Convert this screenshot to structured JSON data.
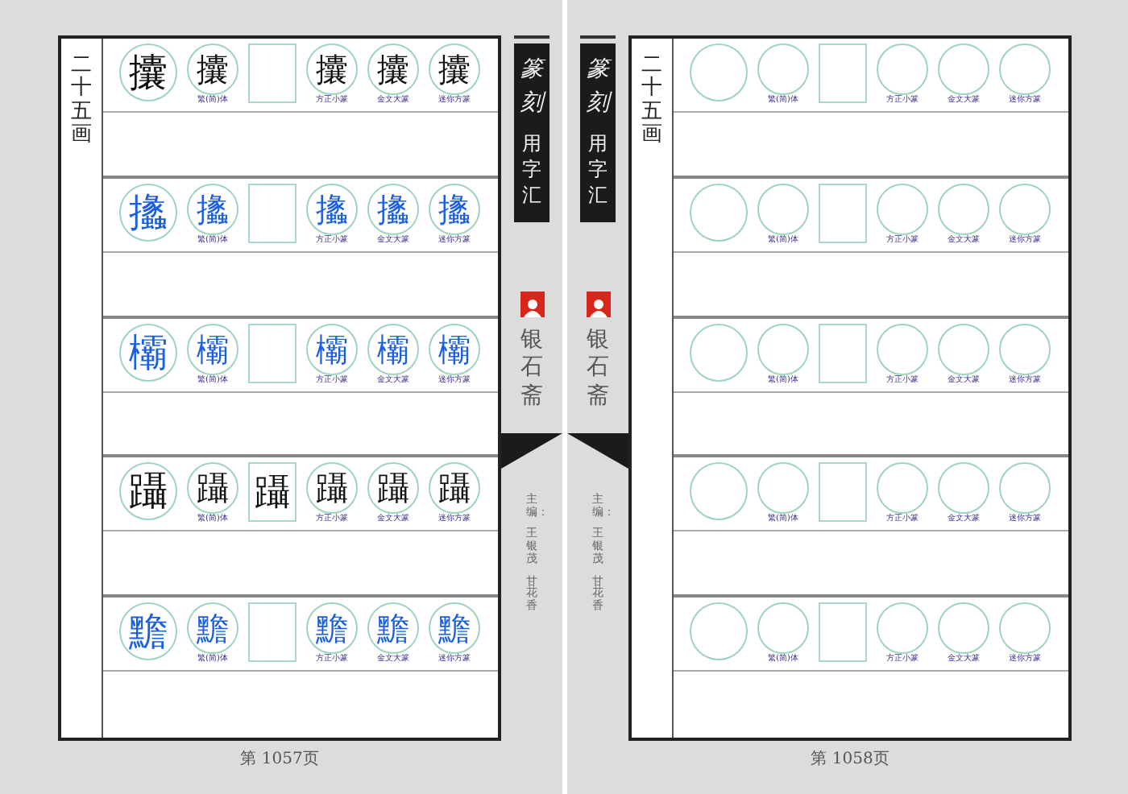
{
  "pages": [
    {
      "stroke_label": "二十五画",
      "page_number": "第 1057页",
      "rows": [
        {
          "color": "#111111",
          "slots": [
            {
              "kind": "large",
              "text": "攮"
            },
            {
              "kind": "small",
              "text": "攮",
              "caption": "繁(简)体"
            },
            {
              "kind": "box"
            },
            {
              "kind": "small",
              "text": "攮",
              "caption": "方正小篆"
            },
            {
              "kind": "small",
              "text": "攮",
              "caption": "金文大篆"
            },
            {
              "kind": "small",
              "text": "攮",
              "caption": "迷你方篆"
            }
          ]
        },
        {
          "color": "#1a5fe0",
          "slots": [
            {
              "kind": "large",
              "text": "攭"
            },
            {
              "kind": "small",
              "text": "攭",
              "caption": "繁(简)体"
            },
            {
              "kind": "box"
            },
            {
              "kind": "small",
              "text": "攭",
              "caption": "方正小篆"
            },
            {
              "kind": "small",
              "text": "攭",
              "caption": "金文大篆"
            },
            {
              "kind": "small",
              "text": "攭",
              "caption": "迷你方篆"
            }
          ]
        },
        {
          "color": "#1a5fe0",
          "slots": [
            {
              "kind": "large",
              "text": "欛"
            },
            {
              "kind": "small",
              "text": "欛",
              "caption": "繁(简)体"
            },
            {
              "kind": "box"
            },
            {
              "kind": "small",
              "text": "欛",
              "caption": "方正小篆"
            },
            {
              "kind": "small",
              "text": "欛",
              "caption": "金文大篆"
            },
            {
              "kind": "small",
              "text": "欛",
              "caption": "迷你方篆"
            }
          ]
        },
        {
          "color": "#111111",
          "slots": [
            {
              "kind": "large",
              "text": "躡"
            },
            {
              "kind": "small",
              "text": "躡",
              "caption": "繁(简)体"
            },
            {
              "kind": "box",
              "text": "躡"
            },
            {
              "kind": "small",
              "text": "躡",
              "caption": "方正小篆"
            },
            {
              "kind": "small",
              "text": "躡",
              "caption": "金文大篆"
            },
            {
              "kind": "small",
              "text": "躡",
              "caption": "迷你方篆"
            }
          ]
        },
        {
          "color": "#1a5fe0",
          "slots": [
            {
              "kind": "large",
              "text": "黵"
            },
            {
              "kind": "small",
              "text": "黵",
              "caption": "繁(简)体"
            },
            {
              "kind": "box"
            },
            {
              "kind": "small",
              "text": "黵",
              "caption": "方正小篆"
            },
            {
              "kind": "small",
              "text": "黵",
              "caption": "金文大篆"
            },
            {
              "kind": "small",
              "text": "黵",
              "caption": "迷你方篆"
            }
          ]
        }
      ]
    },
    {
      "stroke_label": "二十五画",
      "page_number": "第 1058页",
      "rows": [
        {
          "slots": [
            {
              "kind": "large"
            },
            {
              "kind": "small",
              "caption": "繁(简)体"
            },
            {
              "kind": "box"
            },
            {
              "kind": "small",
              "caption": "方正小篆"
            },
            {
              "kind": "small",
              "caption": "金文大篆"
            },
            {
              "kind": "small",
              "caption": "迷你方篆"
            }
          ]
        },
        {
          "slots": [
            {
              "kind": "large"
            },
            {
              "kind": "small",
              "caption": "繁(简)体"
            },
            {
              "kind": "box"
            },
            {
              "kind": "small",
              "caption": "方正小篆"
            },
            {
              "kind": "small",
              "caption": "金文大篆"
            },
            {
              "kind": "small",
              "caption": "迷你方篆"
            }
          ]
        },
        {
          "slots": [
            {
              "kind": "large"
            },
            {
              "kind": "small",
              "caption": "繁(简)体"
            },
            {
              "kind": "box"
            },
            {
              "kind": "small",
              "caption": "方正小篆"
            },
            {
              "kind": "small",
              "caption": "金文大篆"
            },
            {
              "kind": "small",
              "caption": "迷你方篆"
            }
          ]
        },
        {
          "slots": [
            {
              "kind": "large"
            },
            {
              "kind": "small",
              "caption": "繁(简)体"
            },
            {
              "kind": "box"
            },
            {
              "kind": "small",
              "caption": "方正小篆"
            },
            {
              "kind": "small",
              "caption": "金文大篆"
            },
            {
              "kind": "small",
              "caption": "迷你方篆"
            }
          ]
        },
        {
          "slots": [
            {
              "kind": "large"
            },
            {
              "kind": "small",
              "caption": "繁(简)体"
            },
            {
              "kind": "box"
            },
            {
              "kind": "small",
              "caption": "方正小篆"
            },
            {
              "kind": "small",
              "caption": "金文大篆"
            },
            {
              "kind": "small",
              "caption": "迷你方篆"
            }
          ]
        }
      ]
    }
  ],
  "spines": [
    {
      "title_script": "篆刻",
      "title": "用字汇",
      "publisher": "银石斋",
      "editors_label": "主编：",
      "editors": [
        "王银茂",
        "甘花香"
      ]
    },
    {
      "title_script": "篆刻",
      "title": "用字汇",
      "publisher": "银石斋",
      "editors_label": "主编：",
      "editors": [
        "王银茂",
        "甘花香"
      ]
    }
  ]
}
